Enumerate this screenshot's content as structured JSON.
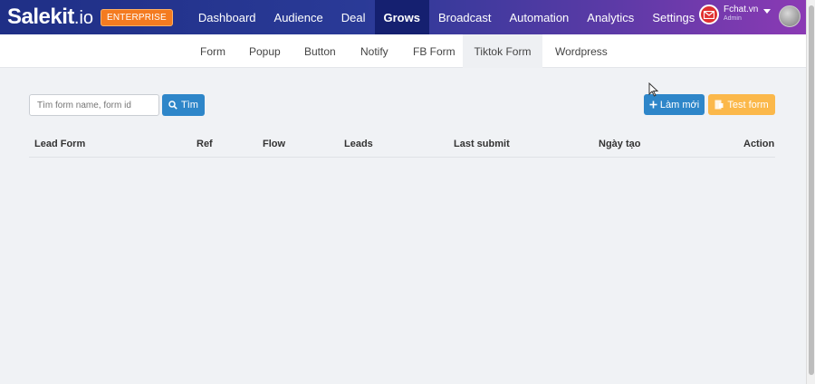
{
  "header": {
    "logo_main": "Salekit",
    "logo_suffix": ".io",
    "badge": "ENTERPRISE",
    "nav": [
      {
        "label": "Dashboard"
      },
      {
        "label": "Audience"
      },
      {
        "label": "Deal"
      },
      {
        "label": "Grows",
        "active": true
      },
      {
        "label": "Broadcast"
      },
      {
        "label": "Automation"
      },
      {
        "label": "Analytics"
      },
      {
        "label": "Settings"
      }
    ],
    "user": {
      "name": "Fchat.vn",
      "role": "Admin"
    }
  },
  "subnav": [
    {
      "label": "Form"
    },
    {
      "label": "Popup"
    },
    {
      "label": "Button"
    },
    {
      "label": "Notify"
    },
    {
      "label": "FB Form"
    },
    {
      "label": "Tiktok Form",
      "active": true
    },
    {
      "label": "Wordpress"
    }
  ],
  "search": {
    "placeholder": "Tìm form name, form id",
    "button_label": "Tìm"
  },
  "actions": {
    "new_label": "Làm mới",
    "test_label": "Test form"
  },
  "table": {
    "columns": [
      "Lead Form",
      "Ref",
      "Flow",
      "Leads",
      "Last submit",
      "Ngày tạo",
      "Action"
    ]
  },
  "colors": {
    "primary": "#2e86c9",
    "warning": "#fbb84a",
    "badge": "#f47b20",
    "nav_active": "#152070"
  }
}
